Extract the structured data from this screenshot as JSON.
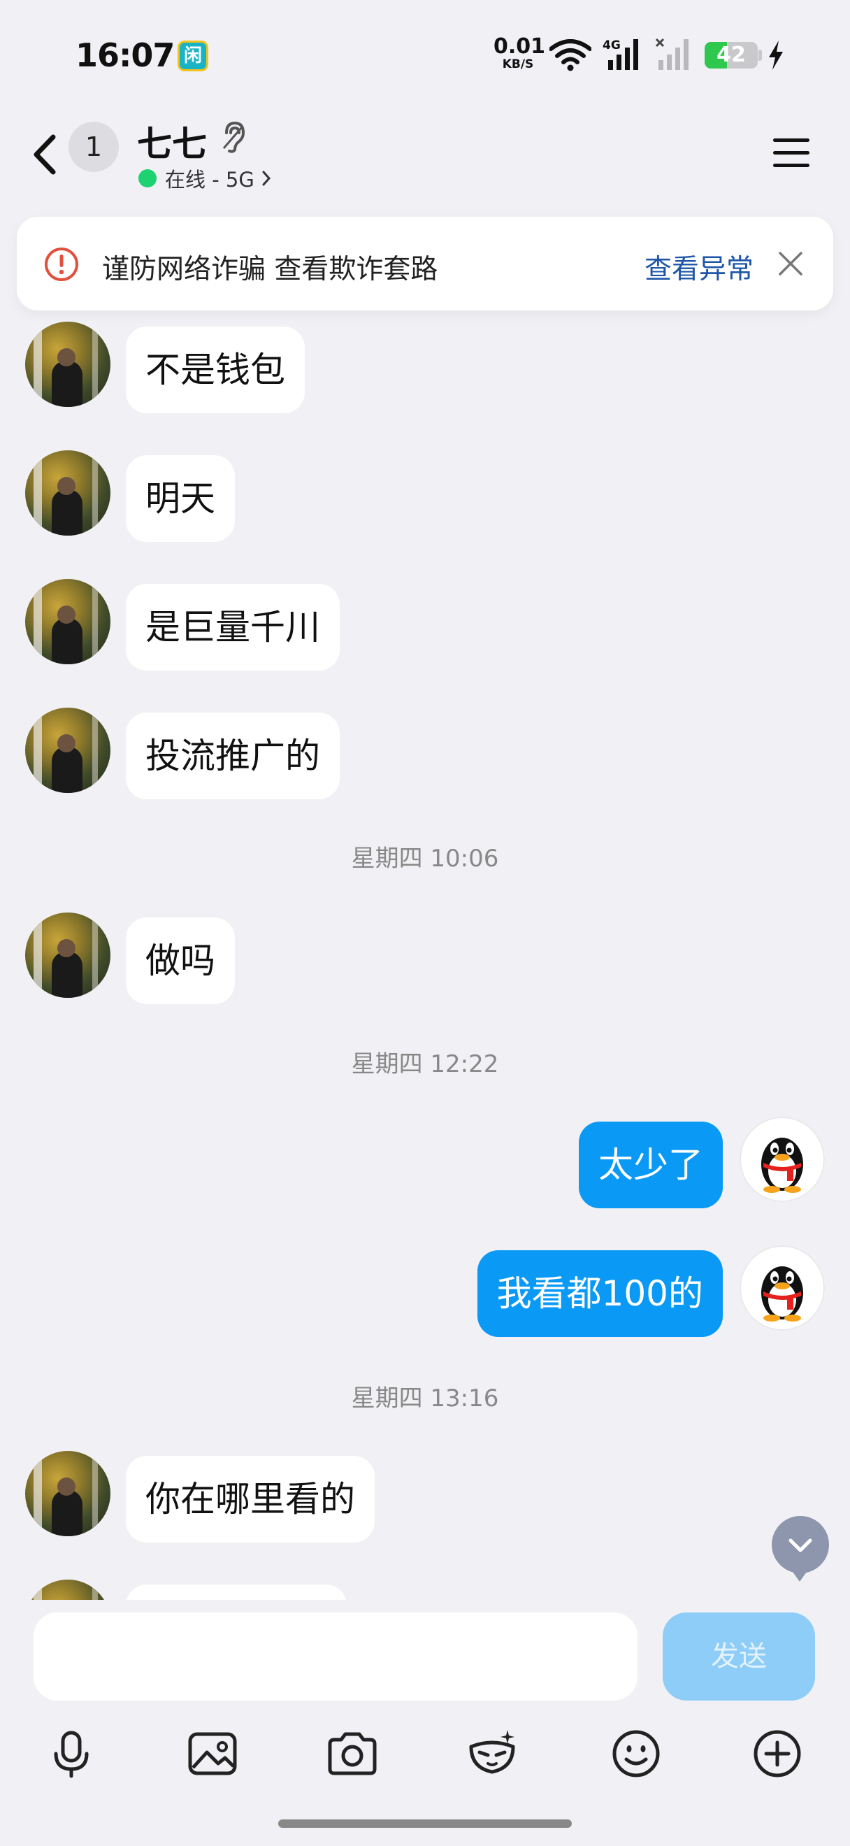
{
  "status_bar": {
    "time": "16:07",
    "app_icon_char": "闲",
    "net_speed_value": "0.01",
    "net_speed_unit": "KB/S",
    "cell_label": "4G",
    "battery_level": "42",
    "battery_fraction": 0.42
  },
  "header": {
    "unread_count": "1",
    "title": "七七",
    "online_status": "在线 - 5G"
  },
  "fraud_banner": {
    "warning": "谨防网络诈骗 查看欺诈套路",
    "link": "查看异常"
  },
  "messages": {
    "m1": "不是钱包",
    "m2": "明天",
    "m3": "是巨量千川",
    "m4": "投流推广的",
    "t1": "星期四 10:06",
    "m5": "做吗",
    "t2": "星期四 12:22",
    "m6": "太少了",
    "m7": "我看都100的",
    "t3": "星期四 13:16",
    "m8": "你在哪里看的"
  },
  "composer": {
    "placeholder": "",
    "send_label": "发送"
  },
  "colors": {
    "background": "#f1f1f5",
    "outgoing_bubble": "#0a99f5",
    "send_button": "#8ecdf7",
    "link": "#1e55a8",
    "online": "#1fd271"
  },
  "icons": {
    "back": "chevron-left-icon",
    "ear": "ear-icon",
    "menu": "hamburger-menu-icon",
    "alert": "alert-circle-icon",
    "close": "close-icon",
    "scroll_down": "chevron-down-icon",
    "tools": [
      "microphone-icon",
      "image-icon",
      "camera-icon",
      "face-mask-icon",
      "emoji-icon",
      "plus-circle-icon"
    ]
  }
}
